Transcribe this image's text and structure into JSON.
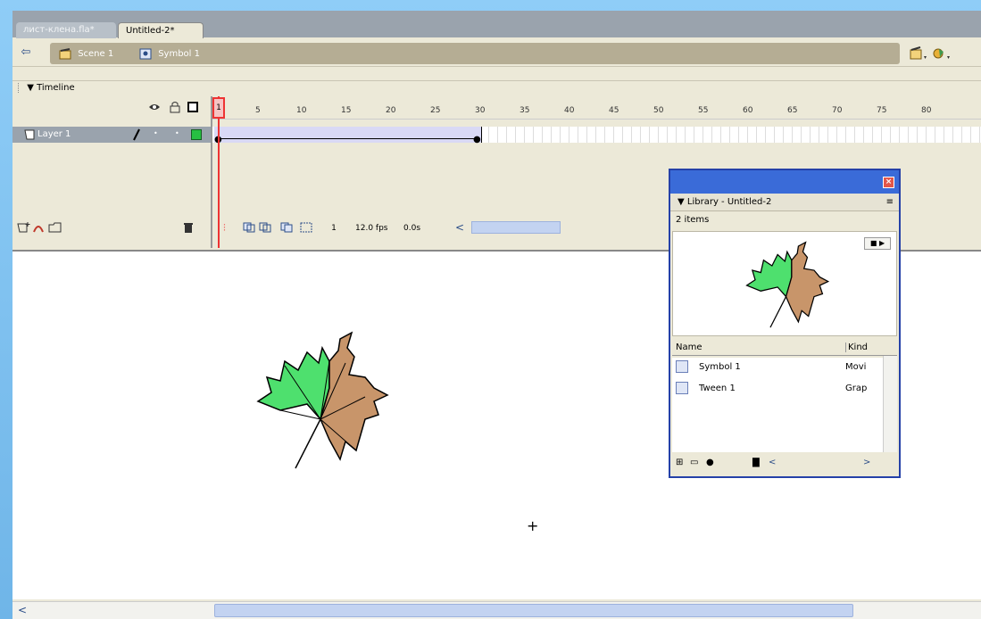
{
  "tabs": [
    {
      "label": "лист-клена.fla*"
    },
    {
      "label": "Untitled-2*"
    }
  ],
  "editbar": {
    "breadcrumbs": [
      {
        "label": "Scene 1"
      },
      {
        "label": "Symbol 1"
      }
    ]
  },
  "timeline": {
    "title": "Timeline",
    "layer": {
      "name": "Layer 1"
    },
    "ruler": [
      "5",
      "10",
      "15",
      "20",
      "25",
      "30",
      "35",
      "40",
      "45",
      "50",
      "55",
      "60",
      "65",
      "70",
      "75",
      "80"
    ],
    "playhead_label": "1",
    "current_frame": "1",
    "fps": "12.0 fps",
    "time": "0.0s"
  },
  "library": {
    "title": "Library - Untitled-2",
    "count": "2 items",
    "col_name": "Name",
    "col_kind": "Kind",
    "items": [
      {
        "name": "Symbol 1",
        "kind": "Movi"
      },
      {
        "name": "Tween 1",
        "kind": "Grap"
      }
    ]
  },
  "colors": {
    "leaf_green": "#4ee06e",
    "leaf_brown": "#c8956a",
    "playhead": "#ee3333",
    "selected_layer_bg": "#9aa3ad"
  },
  "icons": [
    "back-arrow-icon",
    "scene-icon",
    "symbol-icon",
    "edit-scene-icon",
    "edit-symbol-icon",
    "eye-icon",
    "lock-icon",
    "outline-icon",
    "pencil-icon",
    "trash-icon",
    "close-icon",
    "panel-menu-icon",
    "play-icon"
  ]
}
